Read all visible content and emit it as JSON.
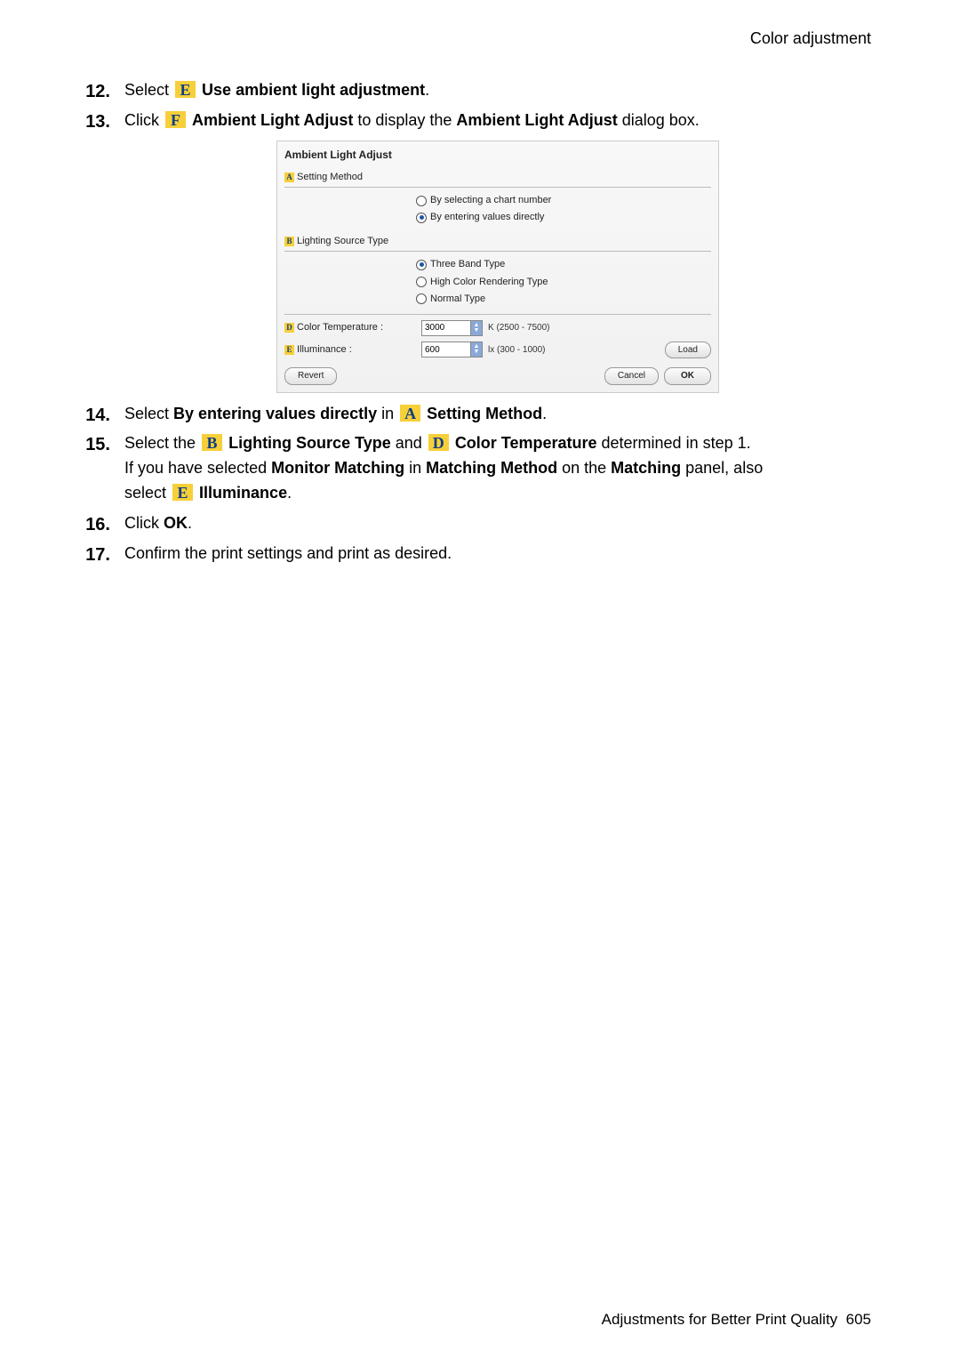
{
  "header": {
    "section": "Color adjustment"
  },
  "steps": {
    "s12": {
      "num": "12.",
      "t1": "Select ",
      "badge": "E",
      "t2": " ",
      "b1": "Use ambient light adjustment",
      "t3": "."
    },
    "s13": {
      "num": "13.",
      "t1": "Click ",
      "badge": "F",
      "t2": " ",
      "b1": "Ambient Light Adjust",
      "t3": " to display the ",
      "b2": "Ambient Light Adjust",
      "t4": " dialog box."
    },
    "s14": {
      "num": "14.",
      "t1": "Select ",
      "b1": "By entering values directly",
      "t2": " in ",
      "badge": "A",
      "t3": " ",
      "b2": "Setting Method",
      "t4": "."
    },
    "s15": {
      "num": "15.",
      "t1": "Select the ",
      "badgeB": "B",
      "bB": "Lighting Source Type",
      "tand": " and ",
      "badgeD": "D",
      "bD": "Color Temperature",
      "t2": " determined in step 1.",
      "line2a": "If you have selected ",
      "b2a": "Monitor Matching",
      "t2b": " in ",
      "b2b": "Matching Method",
      "t2c": " on the ",
      "b2c": "Matching",
      "t2d": " panel, also",
      "line3a": "select ",
      "badgeE": "E",
      "bE": "Illuminance",
      "t3": "."
    },
    "s16": {
      "num": "16.",
      "t1": "Click ",
      "b1": "OK",
      "t2": "."
    },
    "s17": {
      "num": "17.",
      "t1": "Confirm the print settings and print as desired."
    }
  },
  "dialog": {
    "title": "Ambient Light Adjust",
    "sectionA": {
      "badge": "A",
      "label": "Setting Method",
      "opt1": "By selecting a chart number",
      "opt2": "By entering values directly"
    },
    "sectionB": {
      "badge": "B",
      "label": "Lighting Source Type",
      "opt1": "Three Band Type",
      "opt2": "High Color Rendering Type",
      "opt3": "Normal Type"
    },
    "rowD": {
      "badge": "D",
      "label": "Color Temperature :",
      "value": "3000",
      "unit": "K (2500 - 7500)"
    },
    "rowE": {
      "badge": "E",
      "label": "Illuminance :",
      "value": "600",
      "unit": "lx (300 - 1000)"
    },
    "buttons": {
      "load": "Load",
      "revert": "Revert",
      "cancel": "Cancel",
      "ok": "OK"
    }
  },
  "footer": {
    "label": "Adjustments for Better Print Quality",
    "page": "605"
  }
}
